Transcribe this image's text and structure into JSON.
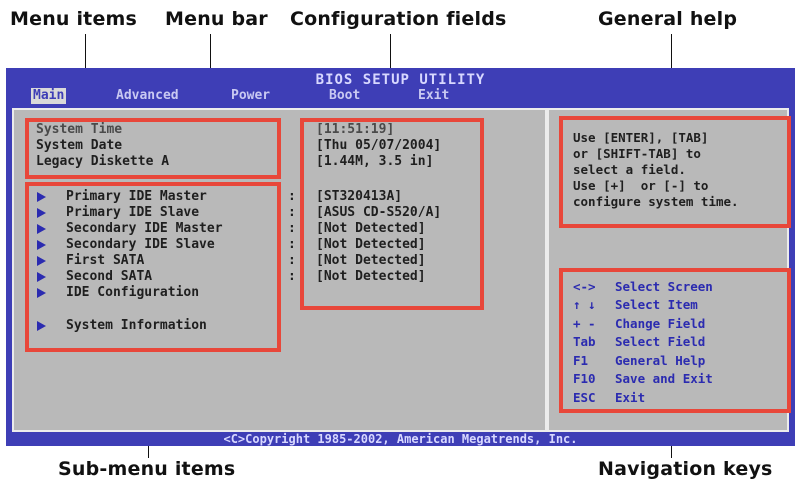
{
  "callouts": {
    "menu_items": "Menu items",
    "menu_bar": "Menu bar",
    "configuration_fields": "Configuration fields",
    "general_help": "General help",
    "sub_menu_items": "Sub-menu items",
    "navigation_keys": "Navigation keys"
  },
  "bios": {
    "title": "BIOS SETUP UTILITY",
    "menus": [
      "Main",
      "Advanced",
      "Power",
      "Boot",
      "Exit"
    ],
    "active_menu": "Main",
    "main_items": [
      "System Time",
      "System Date",
      "Legacy Diskette A"
    ],
    "main_values": [
      "[11:51:19]",
      "[Thu 05/07/2004]",
      "[1.44M, 3.5 in]"
    ],
    "submenus": [
      {
        "label": "Primary IDE Master",
        "value": "[ST320413A]"
      },
      {
        "label": "Primary IDE Slave",
        "value": "[ASUS CD-S520/A]"
      },
      {
        "label": "Secondary IDE Master",
        "value": "[Not Detected]"
      },
      {
        "label": "Secondary IDE Slave",
        "value": "[Not Detected]"
      },
      {
        "label": "First SATA",
        "value": "[Not Detected]"
      },
      {
        "label": "Second SATA",
        "value": "[Not Detected]"
      },
      {
        "label": "IDE Configuration",
        "value": ""
      },
      {
        "label": "System Information",
        "value": ""
      }
    ],
    "help_lines": [
      "Use [ENTER], [TAB]",
      "or [SHIFT-TAB] to",
      "select a field.",
      "Use [+]  or [-] to",
      "configure system time."
    ],
    "nav_keys": [
      {
        "key": "<->",
        "desc": "Select Screen"
      },
      {
        "key": "↑ ↓",
        "desc": "Select Item"
      },
      {
        "key": "+ -",
        "desc": "Change Field"
      },
      {
        "key": "Tab",
        "desc": "Select Field"
      },
      {
        "key": "F1",
        "desc": "General Help"
      },
      {
        "key": "F10",
        "desc": "Save and Exit"
      },
      {
        "key": "ESC",
        "desc": "Exit"
      }
    ],
    "copyright": "<C>Copyright 1985-2002, American Megatrends, Inc."
  },
  "colors": {
    "bios_blue": "#3e3eb6",
    "panel_gray": "#b9b9b9",
    "highlight_red": "#e8473a",
    "nav_text": "#2b2bb0"
  }
}
